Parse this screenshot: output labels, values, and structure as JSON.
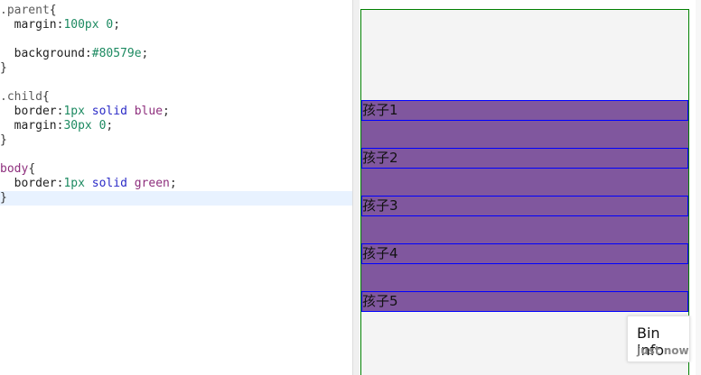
{
  "editor": {
    "lines": [
      [
        {
          "t": ".parent",
          "c": "sel"
        },
        {
          "t": "{",
          "c": "plain"
        }
      ],
      [
        {
          "t": "  margin",
          "c": "prop"
        },
        {
          "t": ":",
          "c": "plain"
        },
        {
          "t": "100px 0",
          "c": "num"
        },
        {
          "t": ";",
          "c": "plain"
        }
      ],
      [],
      [
        {
          "t": "  background",
          "c": "prop"
        },
        {
          "t": ":",
          "c": "plain"
        },
        {
          "t": "#80579e",
          "c": "num"
        },
        {
          "t": ";",
          "c": "plain"
        }
      ],
      [
        {
          "t": "}",
          "c": "plain"
        }
      ],
      [],
      [
        {
          "t": ".child",
          "c": "sel"
        },
        {
          "t": "{",
          "c": "plain"
        }
      ],
      [
        {
          "t": "  border",
          "c": "prop"
        },
        {
          "t": ":",
          "c": "plain"
        },
        {
          "t": "1px ",
          "c": "num"
        },
        {
          "t": "solid ",
          "c": "col"
        },
        {
          "t": "blue",
          "c": "val"
        },
        {
          "t": ";",
          "c": "plain"
        }
      ],
      [
        {
          "t": "  margin",
          "c": "prop"
        },
        {
          "t": ":",
          "c": "plain"
        },
        {
          "t": "30px 0",
          "c": "num"
        },
        {
          "t": ";",
          "c": "plain"
        }
      ],
      [
        {
          "t": "}",
          "c": "plain"
        }
      ],
      [],
      [
        {
          "t": "body",
          "c": "tag"
        },
        {
          "t": "{",
          "c": "plain"
        }
      ],
      [
        {
          "t": "  border",
          "c": "prop"
        },
        {
          "t": ":",
          "c": "plain"
        },
        {
          "t": "1px ",
          "c": "num"
        },
        {
          "t": "solid ",
          "c": "col"
        },
        {
          "t": "green",
          "c": "val"
        },
        {
          "t": ";",
          "c": "plain"
        }
      ],
      [
        {
          "t": "}",
          "c": "plain"
        }
      ]
    ],
    "active_line_index": 13
  },
  "preview": {
    "children": [
      "孩子1",
      "孩子2",
      "孩子3",
      "孩子4",
      "孩子5"
    ],
    "parent_color": "#80579e",
    "child_border_color": "blue",
    "body_border_color": "green"
  },
  "bin_info": {
    "title": "Bin info",
    "time": "just now"
  }
}
